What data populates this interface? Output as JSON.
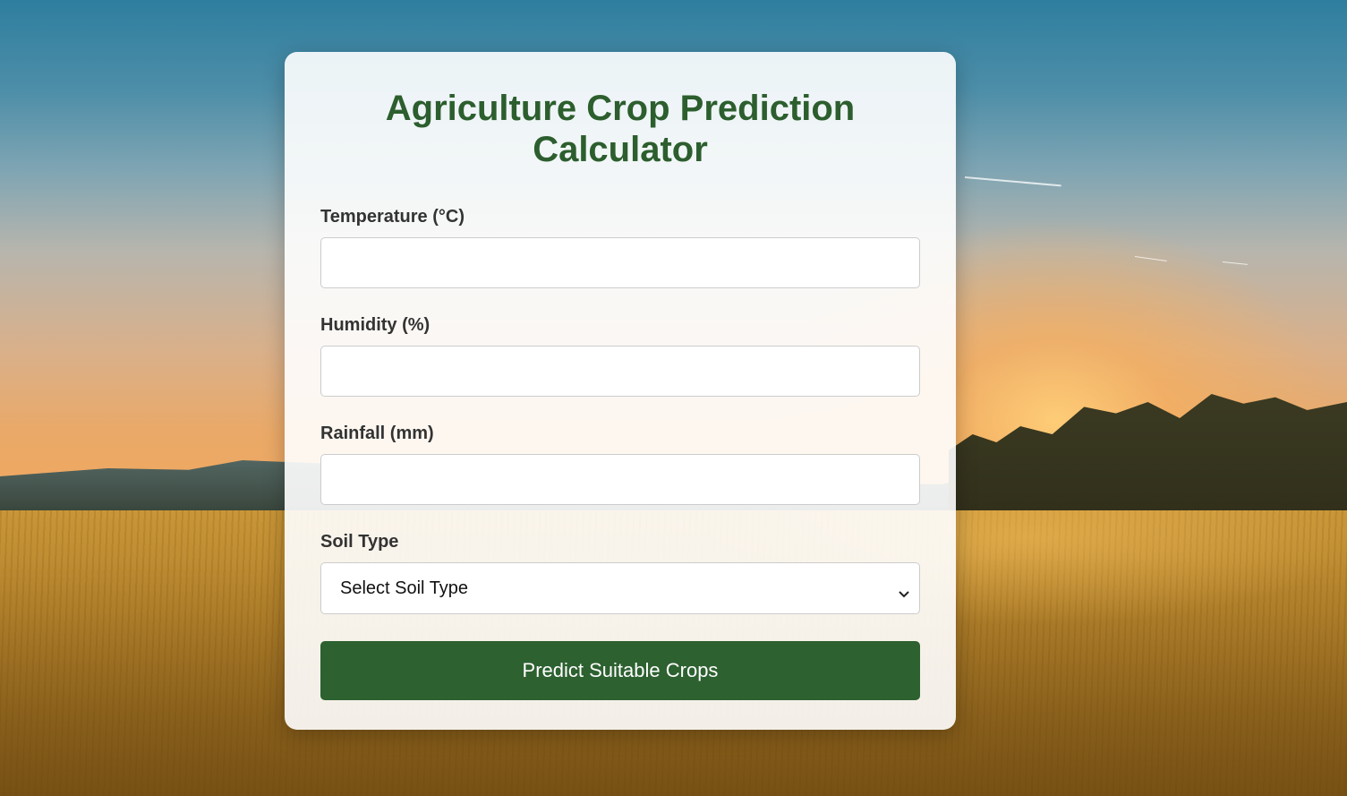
{
  "page": {
    "title": "Agriculture Crop Prediction Calculator"
  },
  "form": {
    "temperature": {
      "label": "Temperature (°C)",
      "value": ""
    },
    "humidity": {
      "label": "Humidity (%)",
      "value": ""
    },
    "rainfall": {
      "label": "Rainfall (mm)",
      "value": ""
    },
    "soil_type": {
      "label": "Soil Type",
      "selected": "Select Soil Type"
    },
    "submit_label": "Predict Suitable Crops"
  },
  "colors": {
    "title_green": "#2c5e2e",
    "button_green": "#2d6130",
    "label_text": "#333333"
  },
  "icons": {
    "select_arrow": "chevron-down-icon"
  }
}
